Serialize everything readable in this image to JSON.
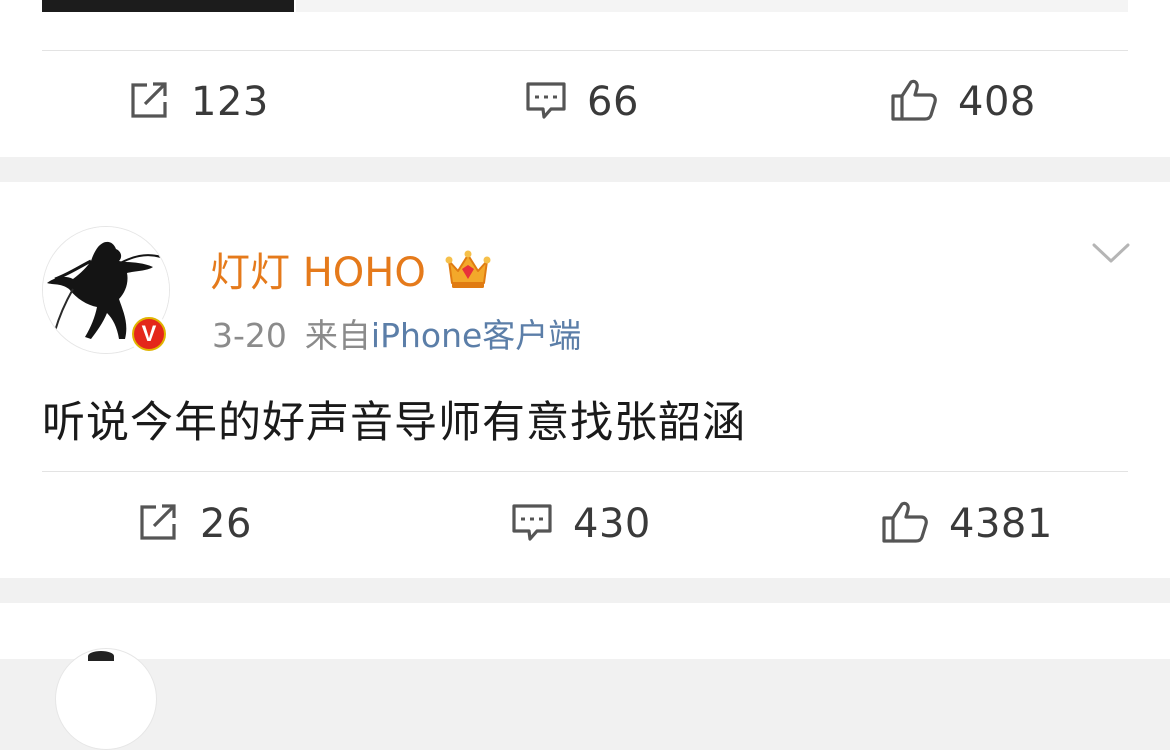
{
  "post1": {
    "repost_count": "123",
    "comment_count": "66",
    "like_count": "408"
  },
  "post2": {
    "username": "灯灯 HOHO",
    "date": "3-20",
    "source_prefix": "来自",
    "source_client": "iPhone客户端",
    "text": "听说今年的好声音导师有意找张韶涵",
    "verified_badge": "V",
    "repost_count": "26",
    "comment_count": "430",
    "like_count": "4381"
  },
  "colors": {
    "username": "#e57a1b",
    "client_link": "#5b7ea8",
    "meta_text": "#8b8b8b",
    "badge_red": "#e4271b",
    "badge_gold": "#e0b400",
    "separator": "#f1f1f1"
  },
  "icons": [
    "repost-icon",
    "comment-icon",
    "like-icon",
    "crown-icon",
    "chevron-down-icon",
    "verified-badge-icon"
  ]
}
